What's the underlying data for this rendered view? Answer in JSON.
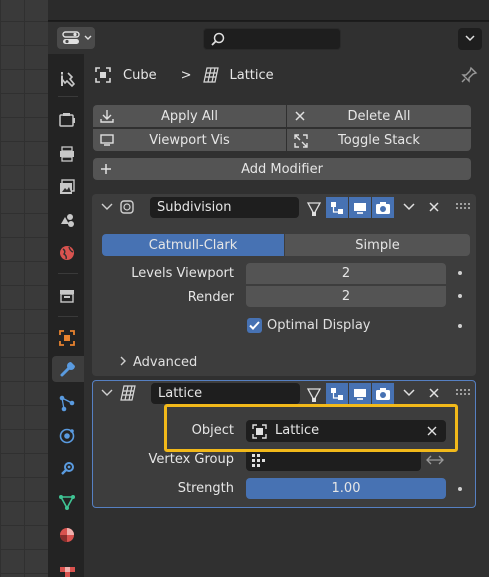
{
  "header": {
    "editor_type_icon": "properties-editor-icon",
    "search_icon": "search-icon",
    "options_icon": "chevron-down-icon"
  },
  "tabs": [
    {
      "name": "tool-tab",
      "icon": "tool-icon"
    },
    {
      "name": "render-tab",
      "icon": "render-icon"
    },
    {
      "name": "output-tab",
      "icon": "output-icon"
    },
    {
      "name": "view-layer-tab",
      "icon": "view-layer-icon"
    },
    {
      "name": "scene-tab",
      "icon": "scene-icon"
    },
    {
      "name": "world-tab",
      "icon": "world-icon"
    },
    {
      "name": "collection-tab",
      "icon": "collection-icon"
    },
    {
      "name": "object-tab",
      "icon": "object-icon"
    },
    {
      "name": "modifiers-tab",
      "icon": "wrench-icon",
      "active": true
    },
    {
      "name": "particles-tab",
      "icon": "particles-icon"
    },
    {
      "name": "physics-tab",
      "icon": "physics-icon"
    },
    {
      "name": "constraints-tab",
      "icon": "constraints-icon"
    },
    {
      "name": "data-tab",
      "icon": "mesh-data-icon"
    },
    {
      "name": "material-tab",
      "icon": "material-icon"
    },
    {
      "name": "texture-tab",
      "icon": "texture-icon"
    }
  ],
  "breadcrumb": {
    "object": "Cube",
    "separator": ">",
    "modifier": "Lattice"
  },
  "toolbar": {
    "apply_all": "Apply All",
    "delete_all": "Delete All",
    "viewport_vis": "Viewport Vis",
    "toggle_stack": "Toggle Stack",
    "add_modifier": "Add Modifier"
  },
  "subdivision": {
    "name": "Subdivision",
    "mode_catmull": "Catmull-Clark",
    "mode_simple": "Simple",
    "levels_viewport_label": "Levels Viewport",
    "levels_viewport_value": "2",
    "render_label": "Render",
    "render_value": "2",
    "optimal_display_label": "Optimal Display",
    "optimal_display_checked": true,
    "advanced_label": "Advanced"
  },
  "lattice": {
    "name": "Lattice",
    "object_label": "Object",
    "object_value": "Lattice",
    "vertex_group_label": "Vertex Group",
    "vertex_group_value": "",
    "strength_label": "Strength",
    "strength_value": "1.00"
  },
  "colors": {
    "accent": "#4772b3",
    "highlight": "#f2b91a",
    "active_outline": "#5680c2"
  }
}
